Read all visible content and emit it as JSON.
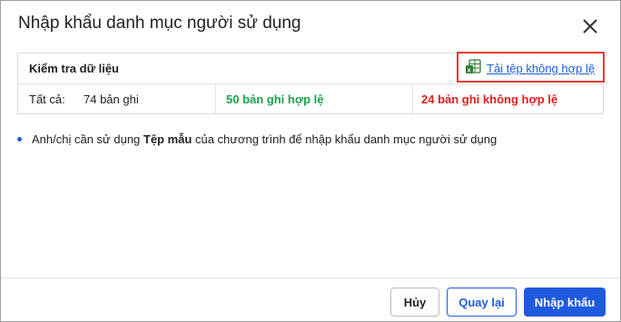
{
  "dialog": {
    "title": "Nhập khẩu danh mục người sử dụng"
  },
  "check": {
    "title": "Kiểm tra dữ liệu",
    "download_label": "Tải tệp không hợp lệ",
    "total_label": "Tất cả:",
    "total_value": "74 bản ghi",
    "valid_text": "50 bản ghi hợp lệ",
    "invalid_text": "24 bản ghi không hợp lệ"
  },
  "note": {
    "prefix": "Anh/chị cần sử dụng ",
    "bold": "Tệp mẫu",
    "suffix": " của chương trình để nhập khẩu danh mục người sử dụng"
  },
  "footer": {
    "cancel_label": "Hủy",
    "back_label": "Quay lại",
    "import_label": "Nhập khẩu"
  },
  "colors": {
    "primary": "#1e5bdc",
    "valid": "#16a34a",
    "invalid": "#e11d1d",
    "highlight_border": "#e53935"
  }
}
